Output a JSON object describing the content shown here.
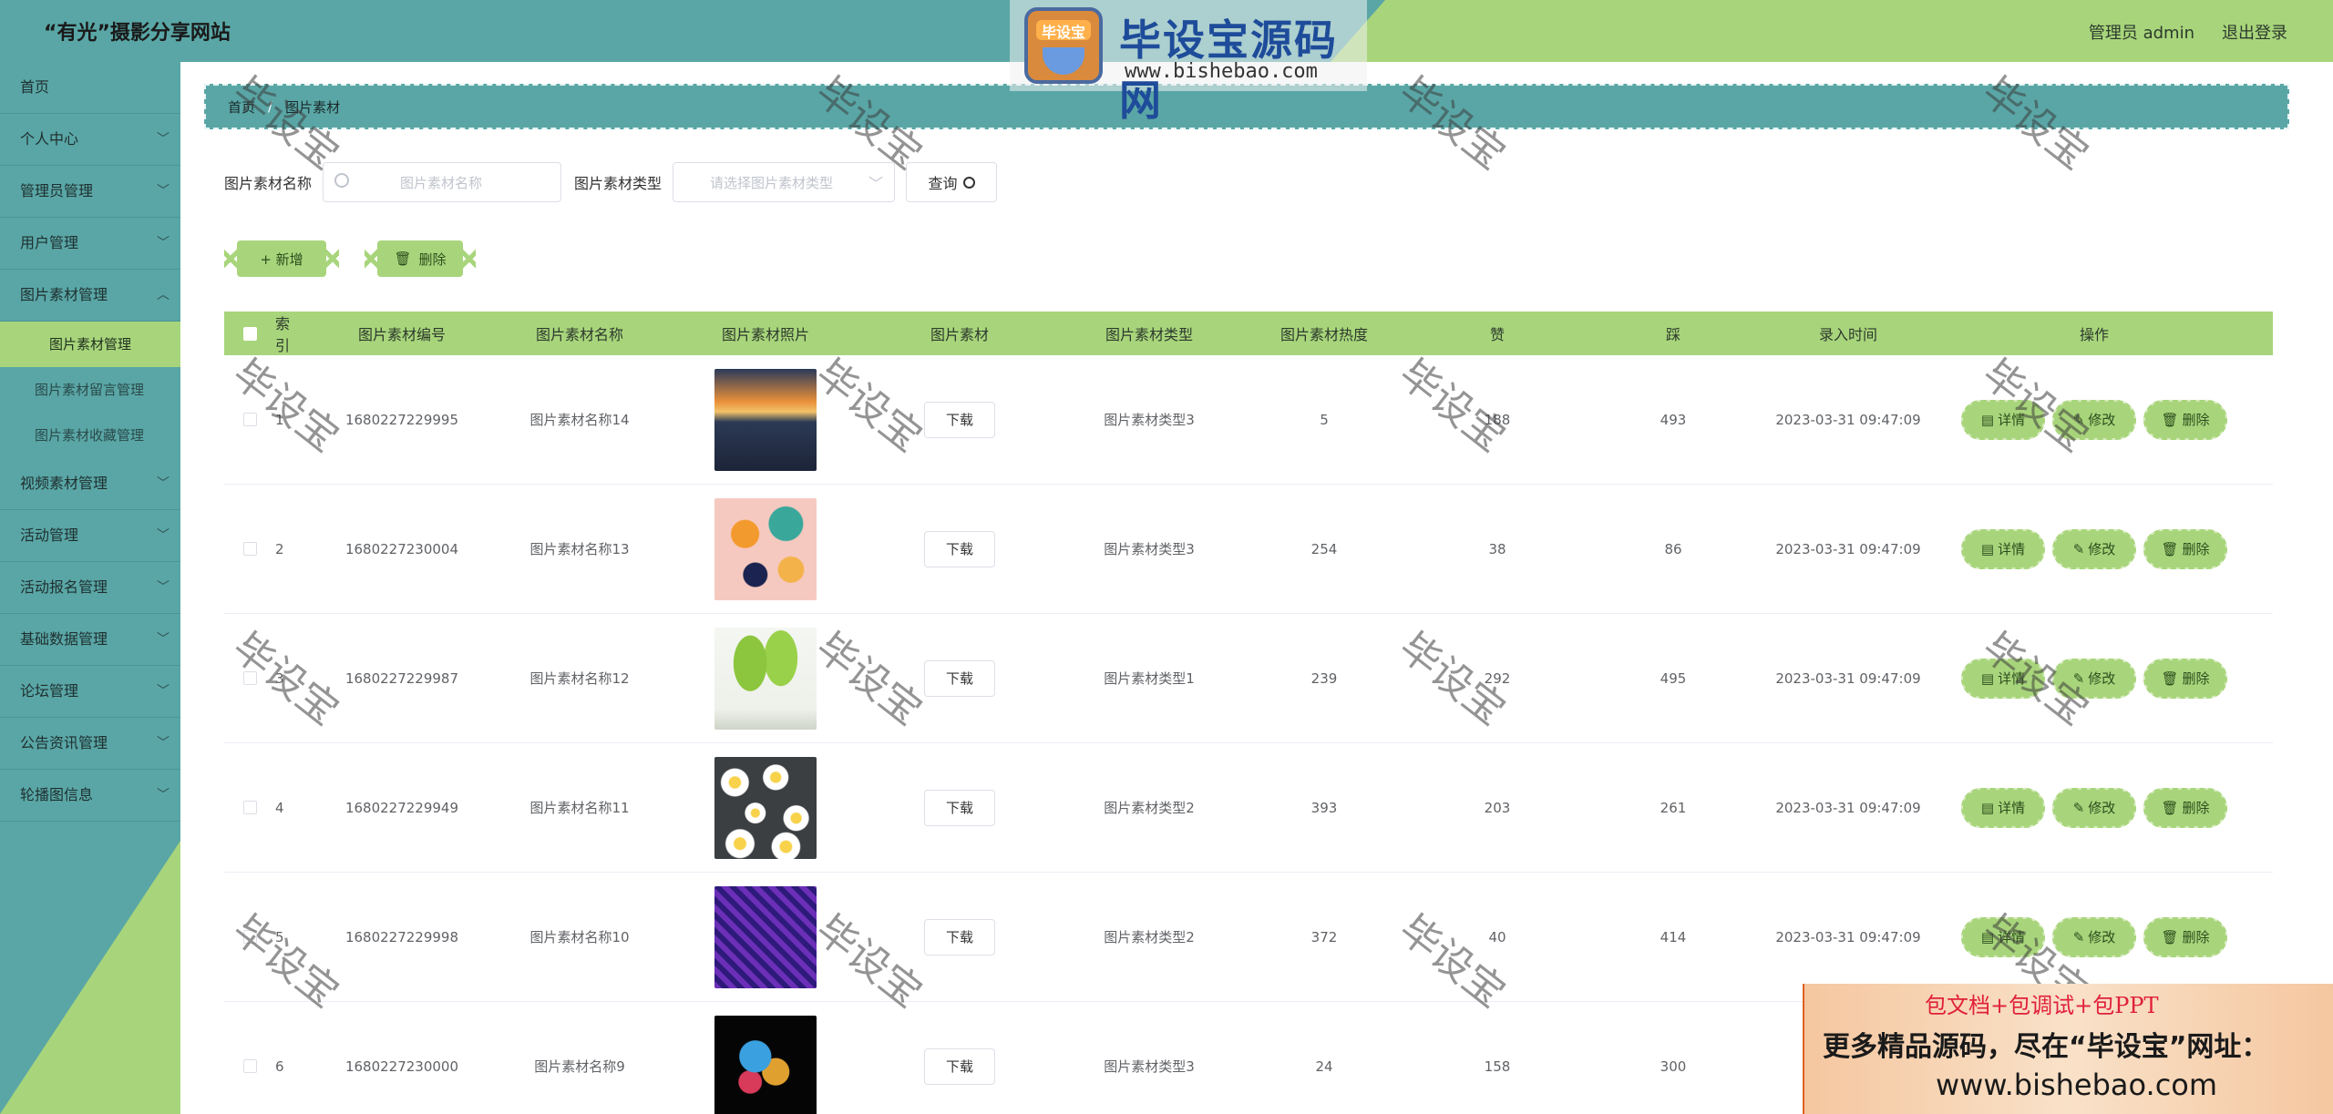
{
  "header": {
    "site_title": "“有光”摄影分享网站",
    "admin_label": "管理员 admin",
    "logout": "退出登录"
  },
  "watermark": {
    "logo_badge": "毕设宝",
    "logo_text": "毕设宝源码网",
    "logo_url": "www.bishebao.com",
    "stamp": "毕设宝"
  },
  "sidebar": {
    "items": [
      {
        "label": "首页",
        "has_chevron": false
      },
      {
        "label": "个人中心",
        "has_chevron": true
      },
      {
        "label": "管理员管理",
        "has_chevron": true
      },
      {
        "label": "用户管理",
        "has_chevron": true
      },
      {
        "label": "图片素材管理",
        "has_chevron": true
      }
    ],
    "sub_items": [
      {
        "label": "图片素材管理",
        "active": true
      },
      {
        "label": "图片素材留言管理",
        "active": false
      },
      {
        "label": "图片素材收藏管理",
        "active": false
      }
    ],
    "items_after": [
      {
        "label": "视频素材管理"
      },
      {
        "label": "活动管理"
      },
      {
        "label": "活动报名管理"
      },
      {
        "label": "基础数据管理"
      },
      {
        "label": "论坛管理"
      },
      {
        "label": "公告资讯管理"
      },
      {
        "label": "轮播图信息"
      }
    ]
  },
  "breadcrumb": {
    "home": "首页",
    "current": "图片素材"
  },
  "filters": {
    "name_label": "图片素材名称",
    "name_placeholder": "图片素材名称",
    "type_label": "图片素材类型",
    "type_placeholder": "请选择图片素材类型",
    "query_label": "查询"
  },
  "toolbar": {
    "add_label": "+ 新增",
    "delete_label": "删除"
  },
  "table": {
    "headers": {
      "index": "索引",
      "no": "图片素材编号",
      "name": "图片素材名称",
      "photo": "图片素材照片",
      "file": "图片素材",
      "type": "图片素材类型",
      "hot": "图片素材热度",
      "like": "赞",
      "dislike": "踩",
      "time": "录入时间",
      "ops": "操作"
    },
    "download_label": "下载",
    "op_labels": {
      "detail": "详情",
      "edit": "修改",
      "delete": "删除"
    },
    "rows": [
      {
        "index": "1",
        "no": "1680227229995",
        "name": "图片素材名称14",
        "type": "图片素材类型3",
        "hot": "5",
        "like": "188",
        "dislike": "493",
        "time": "2023-03-31 09:47:09",
        "photo": "sunset-lake"
      },
      {
        "index": "2",
        "no": "1680227230004",
        "name": "图片素材名称13",
        "type": "图片素材类型3",
        "hot": "254",
        "like": "38",
        "dislike": "86",
        "time": "2023-03-31 09:47:09",
        "photo": "floral-pattern"
      },
      {
        "index": "3",
        "no": "1680227229987",
        "name": "图片素材名称12",
        "type": "图片素材类型1",
        "hot": "239",
        "like": "292",
        "dislike": "495",
        "time": "2023-03-31 09:47:09",
        "photo": "green-sprouts"
      },
      {
        "index": "4",
        "no": "1680227229949",
        "name": "图片素材名称11",
        "type": "图片素材类型2",
        "hot": "393",
        "like": "203",
        "dislike": "261",
        "time": "2023-03-31 09:47:09",
        "photo": "daisies"
      },
      {
        "index": "5",
        "no": "1680227229998",
        "name": "图片素材名称10",
        "type": "图片素材类型2",
        "hot": "372",
        "like": "40",
        "dislike": "414",
        "time": "2023-03-31 09:47:09",
        "photo": "purple-swirl"
      },
      {
        "index": "6",
        "no": "1680227230000",
        "name": "图片素材名称9",
        "type": "图片素材类型3",
        "hot": "24",
        "like": "158",
        "dislike": "300",
        "time": "",
        "photo": "colorful-splash"
      }
    ]
  },
  "ad": {
    "line1": "包文档+包调试+包PPT",
    "line2": "更多精品源码，尽在“毕设宝”网址：",
    "line3": "www.bishebao.com"
  }
}
